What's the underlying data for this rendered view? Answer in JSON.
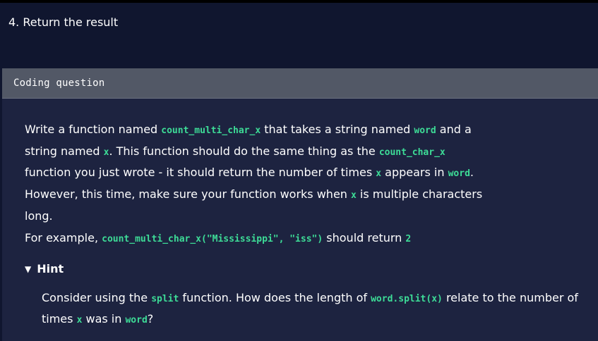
{
  "step": {
    "title": "4. Return the result"
  },
  "panel": {
    "header_label": "Coding question"
  },
  "question": {
    "p1_a": "Write a function named ",
    "p1_code1": "count_multi_char_x",
    "p1_b": " that takes a string named ",
    "p1_code2": "word",
    "p1_c": " and a string named ",
    "p1_code3": "x",
    "p1_d": ". This function should do the same thing as the ",
    "p1_code4": "count_char_x",
    "p1_e": " function you just wrote - it should return the number of times ",
    "p1_code5": "x",
    "p1_f": " appears in ",
    "p1_code6": "word",
    "p1_g": ". However, this time, make sure your function works when ",
    "p1_code7": "x",
    "p1_h": " is multiple characters long.",
    "ex_a": "For example, ",
    "ex_code": "count_multi_char_x(\"Mississippi\", \"iss\")",
    "ex_b": " should return ",
    "ex_code2": "2"
  },
  "hint": {
    "toggle_icon": "triangle-down-icon",
    "toggle_glyph": "▼",
    "label": "Hint",
    "h_a": "Consider using the ",
    "h_code1": "split",
    "h_b": " function. How does the length of ",
    "h_code2": "word.split(x)",
    "h_c": " relate to the number of times ",
    "h_code3": "x",
    "h_d": " was in ",
    "h_code4": "word",
    "h_e": "?"
  },
  "colors": {
    "page_background": "#10162f",
    "panel_background": "#1d2340",
    "header_background": "#525866",
    "code_accent": "#3ddc97"
  }
}
